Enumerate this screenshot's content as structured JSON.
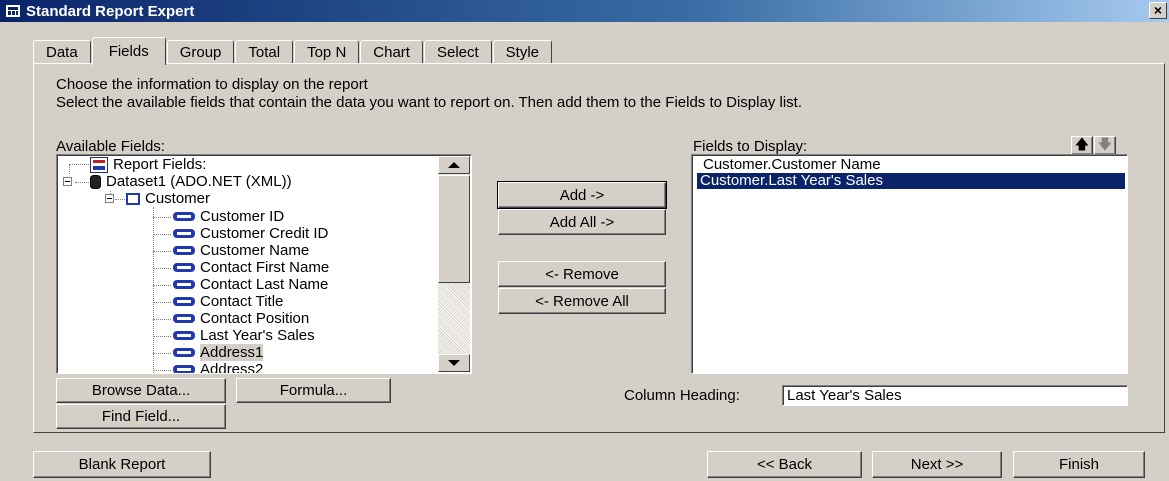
{
  "window": {
    "title": "Standard Report Expert",
    "close_label": "×"
  },
  "tabs": [
    {
      "label": "Data"
    },
    {
      "label": "Fields"
    },
    {
      "label": "Group"
    },
    {
      "label": "Total"
    },
    {
      "label": "Top N"
    },
    {
      "label": "Chart"
    },
    {
      "label": "Select"
    },
    {
      "label": "Style"
    }
  ],
  "active_tab": "Fields",
  "instructions": {
    "line1": "Choose the information to display on the report",
    "line2": "Select the available fields that contain the data you want to report on.  Then add them to the Fields to Display list."
  },
  "available": {
    "label": "Available Fields:",
    "tree": {
      "report_fields": "Report Fields:",
      "dataset": "Dataset1 (ADO.NET (XML))",
      "table": "Customer",
      "fields": [
        "Customer ID",
        "Customer Credit ID",
        "Customer Name",
        "Contact First Name",
        "Contact Last Name",
        "Contact Title",
        "Contact Position",
        "Last Year's Sales",
        "Address1",
        "Address2"
      ],
      "selected_field": "Address1"
    }
  },
  "actions": {
    "add": "Add ->",
    "add_all": "Add All ->",
    "remove": "<- Remove",
    "remove_all": "<- Remove All"
  },
  "display": {
    "label": "Fields to Display:",
    "items": [
      "Customer.Customer Name",
      "Customer.Last Year's Sales"
    ],
    "selected": "Customer.Last Year's Sales",
    "up_icon": "arrow-up-icon",
    "down_icon": "arrow-down-icon"
  },
  "left_buttons": {
    "browse": "Browse Data...",
    "formula": "Formula...",
    "find": "Find Field..."
  },
  "column_heading": {
    "label": "Column Heading:",
    "value": "Last Year's Sales"
  },
  "footer": {
    "blank": "Blank Report",
    "back": "<< Back",
    "next": "Next >>",
    "finish": "Finish"
  },
  "colors": {
    "title_bar": "#0a246a",
    "face": "#d4d0c8",
    "selection": "#0a246a"
  }
}
